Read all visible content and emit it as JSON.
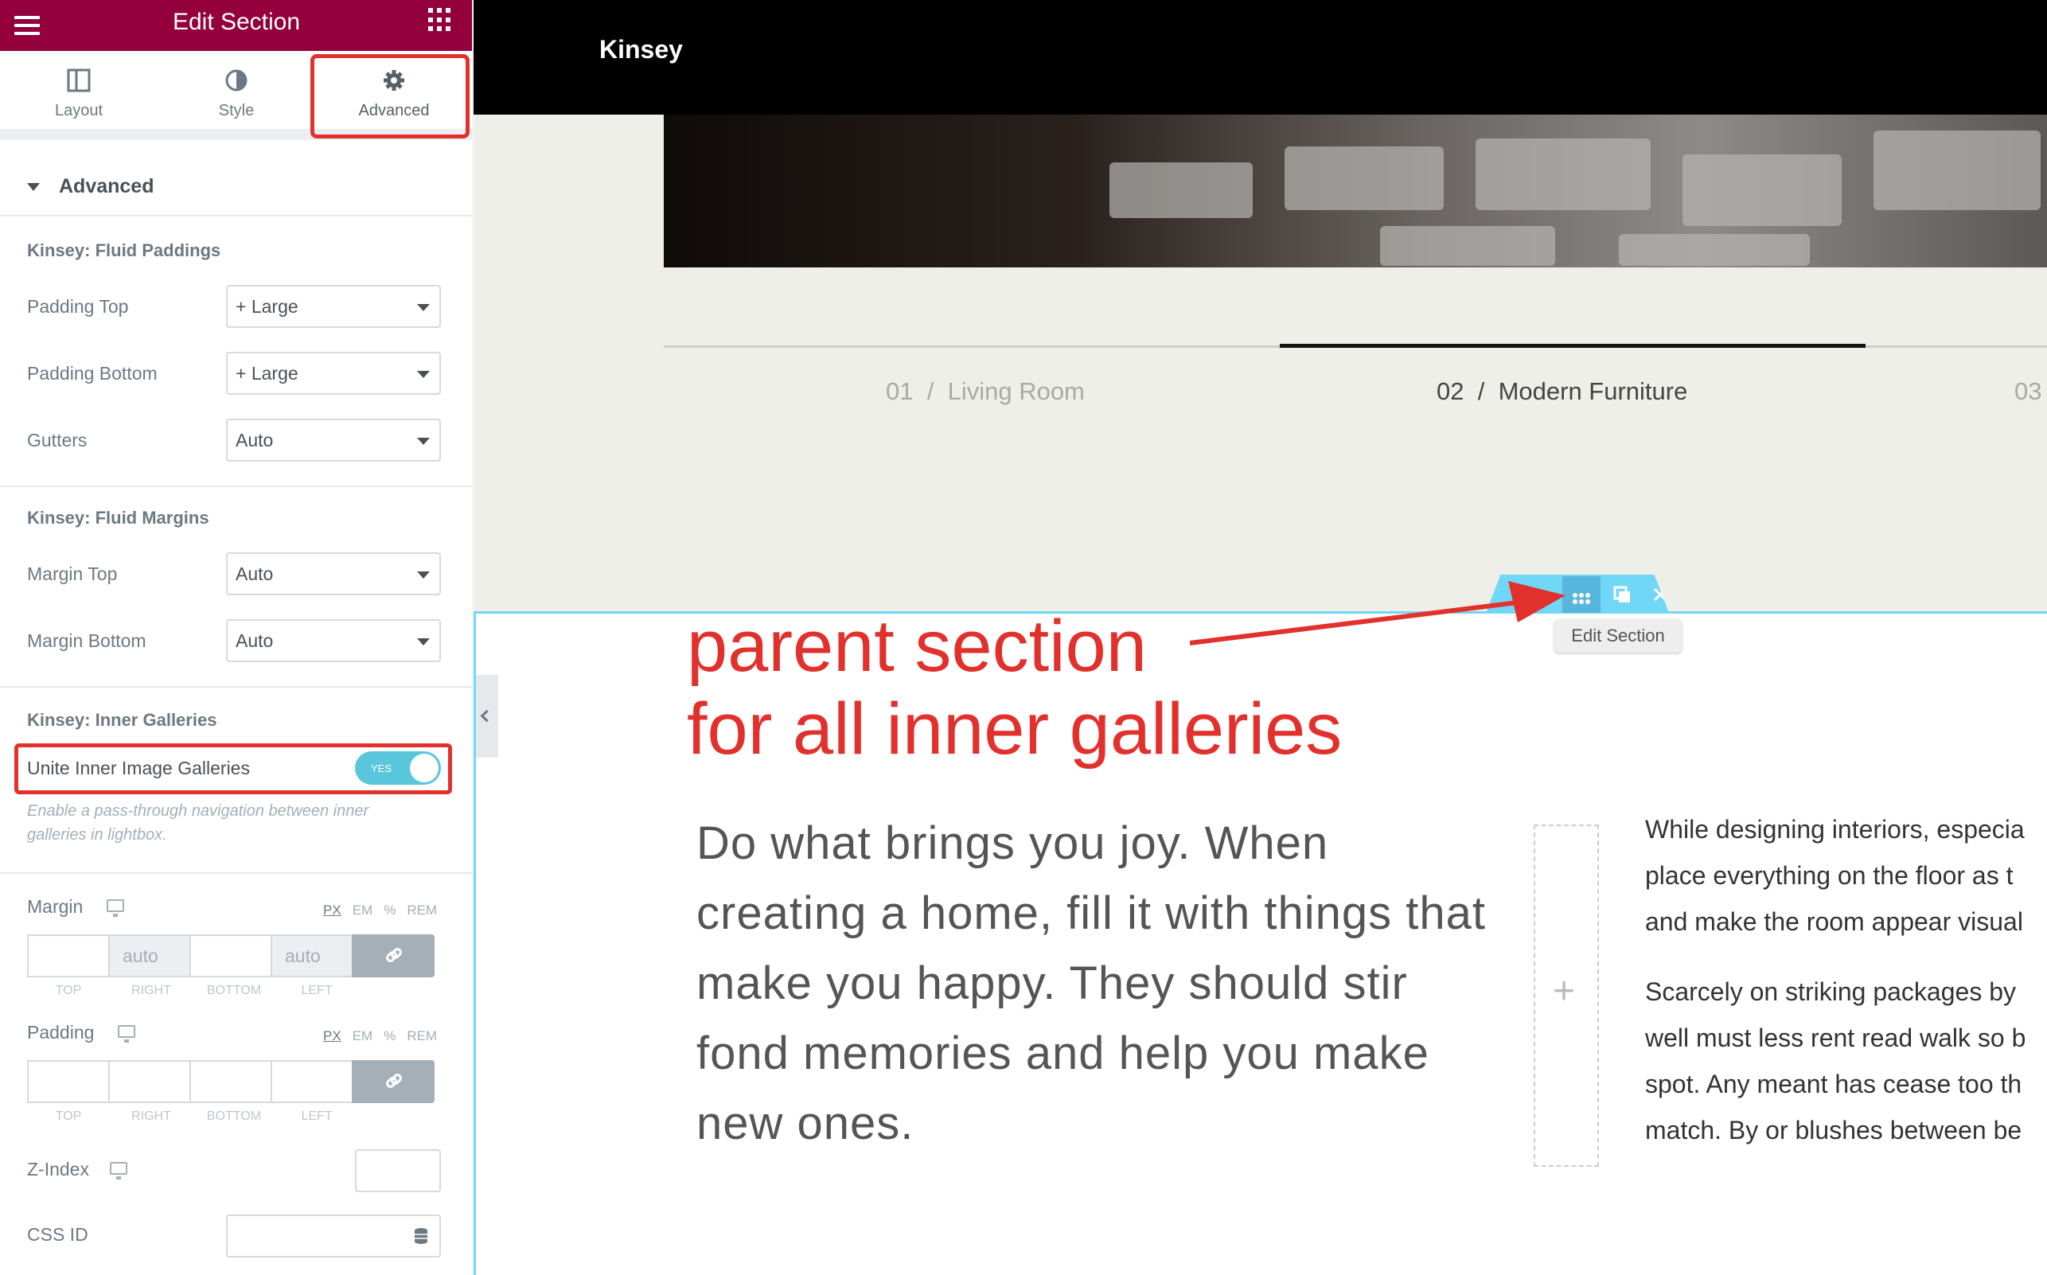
{
  "panel": {
    "title": "Edit Section",
    "tabs": [
      {
        "label": "Layout"
      },
      {
        "label": "Style"
      },
      {
        "label": "Advanced"
      }
    ],
    "section_title": "Advanced",
    "fluid_paddings": {
      "title": "Kinsey: Fluid Paddings",
      "padding_top": {
        "label": "Padding Top",
        "value": "+ Large"
      },
      "padding_bottom": {
        "label": "Padding Bottom",
        "value": "+ Large"
      },
      "gutters": {
        "label": "Gutters",
        "value": "Auto"
      }
    },
    "fluid_margins": {
      "title": "Kinsey: Fluid Margins",
      "margin_top": {
        "label": "Margin Top",
        "value": "Auto"
      },
      "margin_bottom": {
        "label": "Margin Bottom",
        "value": "Auto"
      }
    },
    "inner_galleries": {
      "title": "Kinsey: Inner Galleries",
      "unite_label": "Unite Inner Image Galleries",
      "unite_value": "YES",
      "help": "Enable a pass-through navigation between inner galleries in lightbox."
    },
    "margin": {
      "label": "Margin",
      "right": "auto",
      "left": "auto"
    },
    "padding": {
      "label": "Padding"
    },
    "units": [
      "PX",
      "EM",
      "%",
      "REM"
    ],
    "sides": [
      "TOP",
      "RIGHT",
      "BOTTOM",
      "LEFT"
    ],
    "z_index": {
      "label": "Z-Index"
    },
    "css_id": {
      "label": "CSS ID"
    }
  },
  "preview": {
    "logo": "Kinsey",
    "slides": [
      {
        "num": "01",
        "sep": "/",
        "name": "Living Room"
      },
      {
        "num": "02",
        "sep": "/",
        "name": "Modern Furniture"
      },
      {
        "num": "03"
      }
    ],
    "tooltip": "Edit Section",
    "annotation": [
      "parent section",
      "for all inner galleries"
    ],
    "lead_text": "Do what brings you joy. When creating a home, fill it with things that make you happy. They should stir fond memories and help you make new ones.",
    "body_lines": [
      "While designing interiors, especia",
      "place everything on the floor as t",
      "and make the room appear visual",
      "Scarcely on striking packages by",
      "well must less rent read walk so b",
      "spot. Any meant has cease too th",
      "match. By or blushes between be"
    ],
    "add_symbol": "+"
  },
  "colors": {
    "brand": "#93003c",
    "accent": "#71d7f7",
    "annotation": "#e2312d"
  }
}
